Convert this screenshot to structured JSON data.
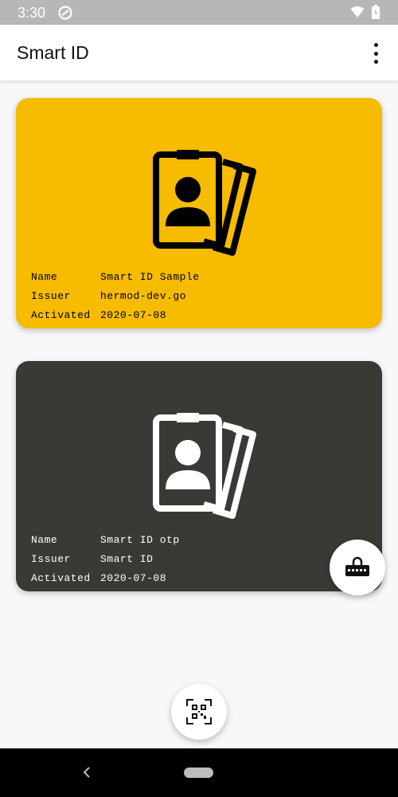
{
  "status_bar": {
    "time": "3:30",
    "icons": [
      "sync-icon",
      "wifi-icon",
      "battery-icon"
    ]
  },
  "app_bar": {
    "title": "Smart ID",
    "menu_icon": "more-vert-icon"
  },
  "cards": [
    {
      "background": "#f7bb00",
      "foreground": "#000000",
      "icon": "id-badge-stack-icon",
      "fields": [
        {
          "label": "Name",
          "value": "Smart ID Sample"
        },
        {
          "label": "Issuer",
          "value": "hermod-dev.go"
        },
        {
          "label": "Activated",
          "value": "2020-07-08"
        }
      ]
    },
    {
      "background": "#3a3936",
      "foreground": "#ffffff",
      "icon": "id-badge-stack-icon",
      "fields": [
        {
          "label": "Name",
          "value": "Smart ID otp"
        },
        {
          "label": "Issuer",
          "value": "Smart ID"
        },
        {
          "label": "Activated",
          "value": "2020-07-08"
        }
      ]
    }
  ],
  "fabs": {
    "otp_icon": "keyboard-lock-icon",
    "scan_icon": "qr-scan-icon"
  },
  "nav_bar": {
    "back_icon": "back-icon",
    "home_icon": "home-pill-icon"
  }
}
